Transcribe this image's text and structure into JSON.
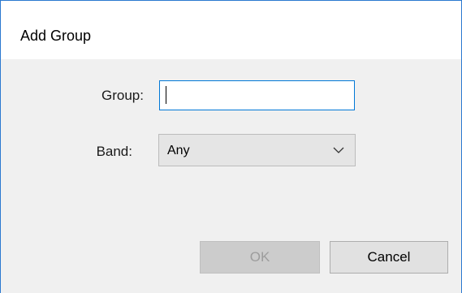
{
  "dialog": {
    "title": "Add Group"
  },
  "form": {
    "group_label": "Group:",
    "group_value": "",
    "band_label": "Band:",
    "band_selected": "Any"
  },
  "buttons": {
    "ok_label": "OK",
    "cancel_label": "Cancel"
  },
  "icons": {
    "dropdown": "chevron-down-icon"
  },
  "colors": {
    "accent": "#0078d7",
    "window_border": "#2b79d0",
    "disabled_text": "#9d9d9d"
  }
}
